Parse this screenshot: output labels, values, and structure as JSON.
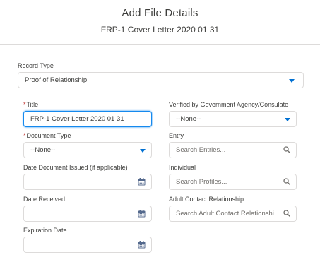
{
  "header": {
    "title": "Add File Details",
    "subtitle": "FRP-1 Cover Letter 2020 01 31"
  },
  "record_type": {
    "label": "Record Type",
    "value": "Proof of Relationship"
  },
  "left": {
    "title": {
      "label": "Title",
      "required": "*",
      "value": "FRP-1 Cover Letter 2020 01 31"
    },
    "document_type": {
      "label": "Document Type",
      "required": "*",
      "value": "--None--"
    },
    "date_issued": {
      "label": "Date Document Issued (if applicable)",
      "value": ""
    },
    "date_received": {
      "label": "Date Received",
      "value": ""
    },
    "expiration_date": {
      "label": "Expiration Date",
      "value": ""
    }
  },
  "right": {
    "verified": {
      "label": "Verified by Government Agency/Consulate",
      "value": "--None--"
    },
    "entry": {
      "label": "Entry",
      "placeholder": "Search Entries..."
    },
    "individual": {
      "label": "Individual",
      "placeholder": "Search Profiles..."
    },
    "adult_contact": {
      "label": "Adult Contact Relationship",
      "placeholder": "Search Adult Contact Relationshi"
    }
  },
  "colors": {
    "accent": "#0070d2",
    "required": "#c23934",
    "focus": "#1589ee"
  },
  "icons": [
    "chevron-down-icon",
    "calendar-icon",
    "search-icon"
  ]
}
